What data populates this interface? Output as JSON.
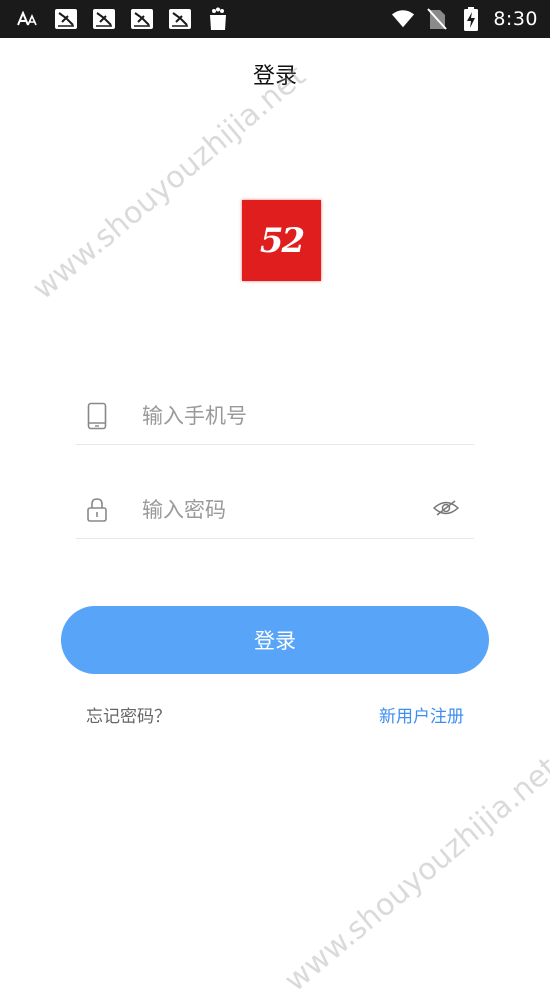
{
  "status_bar": {
    "time": "8:30",
    "notification_icons": [
      "font-app-icon",
      "app-notification-icon",
      "app-notification-icon",
      "app-notification-icon",
      "app-notification-icon",
      "shopping-bag-icon"
    ],
    "system_icons": [
      "wifi-icon",
      "no-sim-icon",
      "battery-charging-icon"
    ]
  },
  "header": {
    "title": "登录"
  },
  "logo": {
    "text": "52",
    "background_color": "#e01e1e"
  },
  "form": {
    "phone": {
      "placeholder": "输入手机号",
      "value": "",
      "icon": "phone-icon"
    },
    "password": {
      "placeholder": "输入密码",
      "value": "",
      "icon": "lock-icon",
      "toggle_icon": "eye-hidden-icon"
    }
  },
  "actions": {
    "login_label": "登录",
    "forgot_password": "忘记密码？",
    "register": "新用户注册"
  },
  "colors": {
    "accent": "#58a4f8",
    "link": "#3d8ef0",
    "status_bar": "#1a1a1a"
  },
  "watermarks": [
    "www.shouyouzhijia.net",
    "www.shouyouzhijia.net"
  ]
}
